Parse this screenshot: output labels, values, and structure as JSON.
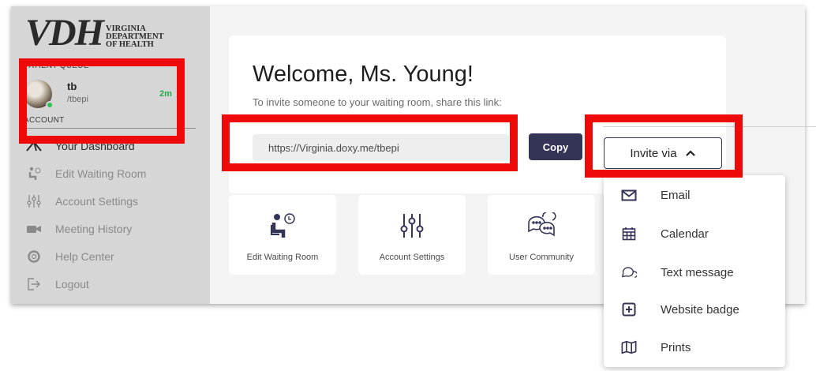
{
  "logo": {
    "mark": "VDH",
    "line1": "VIRGINIA",
    "line2": "DEPARTMENT",
    "line3": "OF HEALTH"
  },
  "sidebar": {
    "queue_label": "PATIENT QUEUE",
    "queue": [
      {
        "name": "tb",
        "room": "/tbepi",
        "wait": "2m",
        "status_color": "#2fbf56"
      }
    ],
    "account_label": "ACCOUNT",
    "items": [
      {
        "label": "Your Dashboard",
        "icon": "dashboard-gauge-icon",
        "active": true
      },
      {
        "label": "Edit Waiting Room",
        "icon": "waiting-room-icon",
        "active": false
      },
      {
        "label": "Account Settings",
        "icon": "settings-sliders-icon",
        "active": false
      },
      {
        "label": "Meeting History",
        "icon": "camera-icon",
        "active": false
      },
      {
        "label": "Help Center",
        "icon": "lifebuoy-icon",
        "active": false
      },
      {
        "label": "Logout",
        "icon": "logout-icon",
        "active": false
      }
    ]
  },
  "main": {
    "welcome": "Welcome, Ms. Young!",
    "invite_hint": "To invite someone to your waiting room, share this link:",
    "room_link": "https://Virginia.doxy.me/tbepi",
    "copy_label": "Copy",
    "invite_via_label": "Invite via",
    "tiles": [
      {
        "label": "Edit Waiting Room",
        "icon": "waiting-room-icon"
      },
      {
        "label": "Account Settings",
        "icon": "settings-sliders-icon"
      },
      {
        "label": "User Community",
        "icon": "chat-bubbles-icon"
      }
    ]
  },
  "invite_menu": [
    {
      "label": "Email",
      "icon": "envelope-icon"
    },
    {
      "label": "Calendar",
      "icon": "calendar-icon"
    },
    {
      "label": "Text message",
      "icon": "speech-bubbles-icon"
    },
    {
      "label": "Website badge",
      "icon": "plus-square-icon"
    },
    {
      "label": "Prints",
      "icon": "map-fold-icon"
    }
  ],
  "colors": {
    "sidebar": "#d6d6d6",
    "brand_dark": "#333456",
    "online": "#2fbf56",
    "highlight": "#ef0a0a"
  }
}
